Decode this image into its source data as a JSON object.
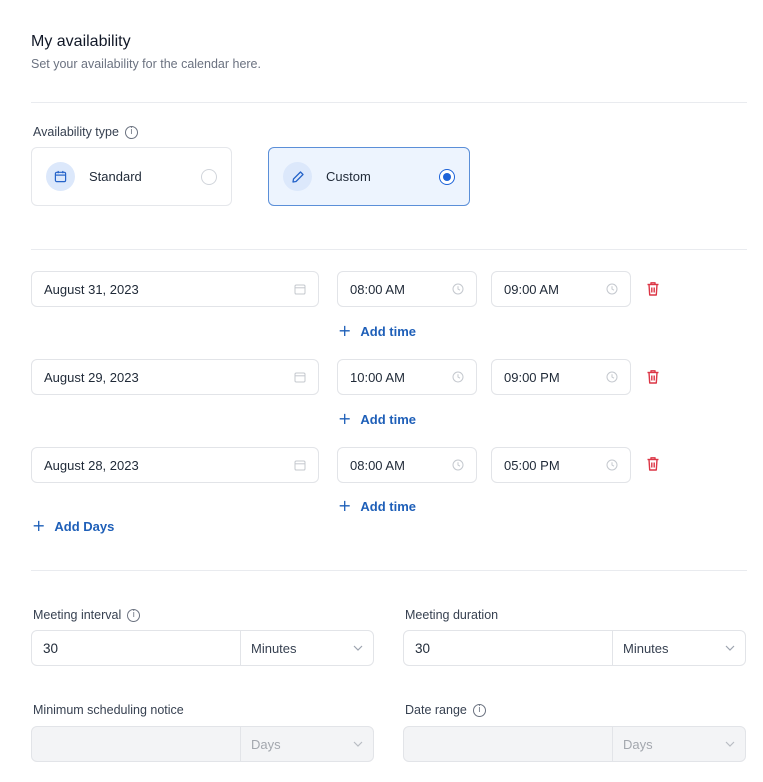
{
  "header": {
    "title": "My availability",
    "subtitle": "Set your availability for the calendar here."
  },
  "availability_type": {
    "label": "Availability type",
    "options": [
      {
        "label": "Standard",
        "icon": "calendar-icon",
        "selected": false
      },
      {
        "label": "Custom",
        "icon": "pencil-icon",
        "selected": true
      }
    ]
  },
  "days": [
    {
      "date": "August 31, 2023",
      "start": "08:00 AM",
      "end": "09:00 AM",
      "add_time_label": "Add time"
    },
    {
      "date": "August 29, 2023",
      "start": "10:00 AM",
      "end": "09:00 PM",
      "add_time_label": "Add time"
    },
    {
      "date": "August 28, 2023",
      "start": "08:00 AM",
      "end": "05:00 PM",
      "add_time_label": "Add time"
    }
  ],
  "add_days_label": "Add Days",
  "meeting_interval": {
    "label": "Meeting interval",
    "value": "30",
    "unit": "Minutes"
  },
  "meeting_duration": {
    "label": "Meeting duration",
    "value": "30",
    "unit": "Minutes"
  },
  "minimum_notice": {
    "label": "Minimum scheduling notice",
    "value": "",
    "unit": "Days"
  },
  "date_range": {
    "label": "Date range",
    "value": "",
    "unit": "Days"
  },
  "colors": {
    "accent": "#1d63d8",
    "link": "#1e5fb8",
    "danger": "#dc3545",
    "selected_card_bg": "#edf4fe"
  }
}
